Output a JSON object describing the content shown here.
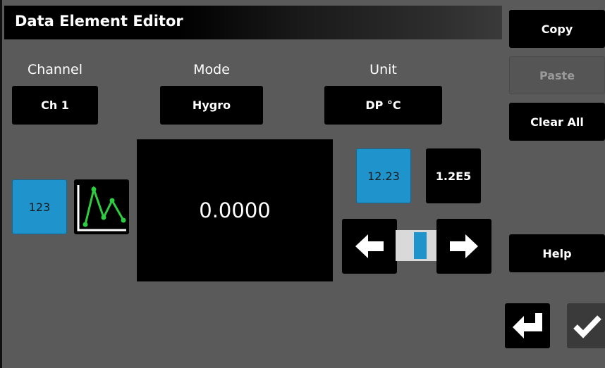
{
  "window": {
    "title": "Data Element Editor"
  },
  "fields": {
    "channel": {
      "label": "Channel",
      "value": "Ch 1"
    },
    "mode": {
      "label": "Mode",
      "value": "Hygro"
    },
    "unit": {
      "label": "Unit",
      "value": "DP °C"
    }
  },
  "side_buttons": {
    "copy": "Copy",
    "paste": "Paste",
    "clear_all": "Clear All",
    "help": "Help"
  },
  "display_type": {
    "numeric_label": "123",
    "numeric_selected": true,
    "graph_icon": "line-graph-icon"
  },
  "reading": {
    "value": "0.0000"
  },
  "format": {
    "decimal_label": "12.23",
    "decimal_selected": true,
    "scientific_label": "1.2E5"
  },
  "resolution": {
    "left_icon": "arrow-left-icon",
    "right_icon": "arrow-right-icon",
    "level": 0.5
  },
  "actions": {
    "back_icon": "return-arrow-icon",
    "accept_icon": "checkmark-icon"
  },
  "colors": {
    "accent": "#1f94cc",
    "background": "#5a5a5a",
    "graph_line": "#2ecc40"
  }
}
